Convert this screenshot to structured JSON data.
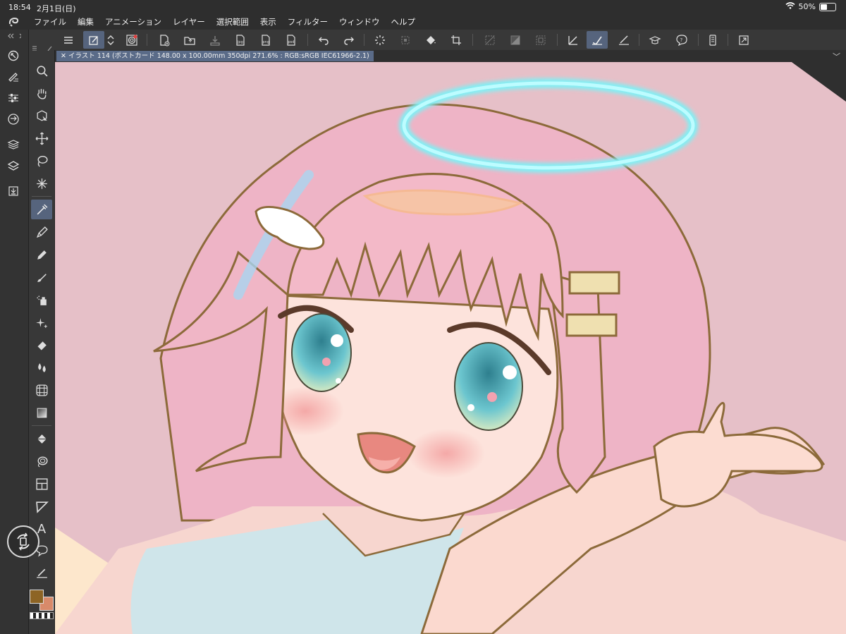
{
  "status": {
    "time": "18:54",
    "date": "2月1日(日)",
    "battery": "50%"
  },
  "menu": [
    "ファイル",
    "編集",
    "アニメーション",
    "レイヤー",
    "選択範囲",
    "表示",
    "フィルター",
    "ウィンドウ",
    "ヘルプ"
  ],
  "toolbar": {
    "icons": [
      "menu-icon",
      "new-canvas-icon",
      "expand-icon",
      "spiral-icon",
      "new-file-icon",
      "open-folder-icon",
      "save-icon",
      "export-jpg-icon",
      "export-png-icon",
      "export-psd-icon",
      "undo-icon",
      "redo-icon",
      "loading-icon",
      "transform-icon",
      "fill-icon",
      "crop-icon",
      "selection-icon",
      "gradient-icon",
      "deselect-icon",
      "pen-icon",
      "brush-icon",
      "eraser-icon",
      "learn-icon",
      "help-icon",
      "device-icon",
      "fullscreen-icon"
    ],
    "active": [
      "new-canvas-icon",
      "brush-icon"
    ],
    "labels": {
      "jpg": "jpg",
      "png": "png",
      "psd": "psd"
    }
  },
  "left_panel_icons": [
    "navigator-icon",
    "pen-settings-icon",
    "sliders-icon",
    "sync-icon",
    "layers-stack-icon",
    "layers-icon",
    "import-icon"
  ],
  "tools": [
    "zoom-tool-icon",
    "hand-tool-icon",
    "select-tool-icon",
    "move-tool-icon",
    "lasso-tool-icon",
    "magic-wand-icon",
    "eyedropper-tool-icon",
    "pen-tool-icon",
    "pencil-tool-icon",
    "brush-tool-icon",
    "airbrush-tool-icon",
    "sparkle-tool-icon",
    "eraser-tool-icon",
    "blend-tool-icon",
    "grid-tool-icon",
    "gradient-tool-icon",
    "fill-tool-icon",
    "lasso-fill-icon",
    "frame-tool-icon",
    "ruler-tool-icon",
    "text-tool-icon",
    "balloon-tool-icon",
    "line-tool-icon"
  ],
  "tool_labels": {
    "text": "A"
  },
  "document": {
    "tab_label": "イラスト 114 (ポストカード 148.00 x 100.00mm 350dpi 271.6% : RGB:sRGB IEC61966-2.1)"
  },
  "colors": {
    "main": "#8d6424",
    "sub": "#d88a6a",
    "accent": "#56647d",
    "canvas_bg": "#e6c0c8"
  }
}
